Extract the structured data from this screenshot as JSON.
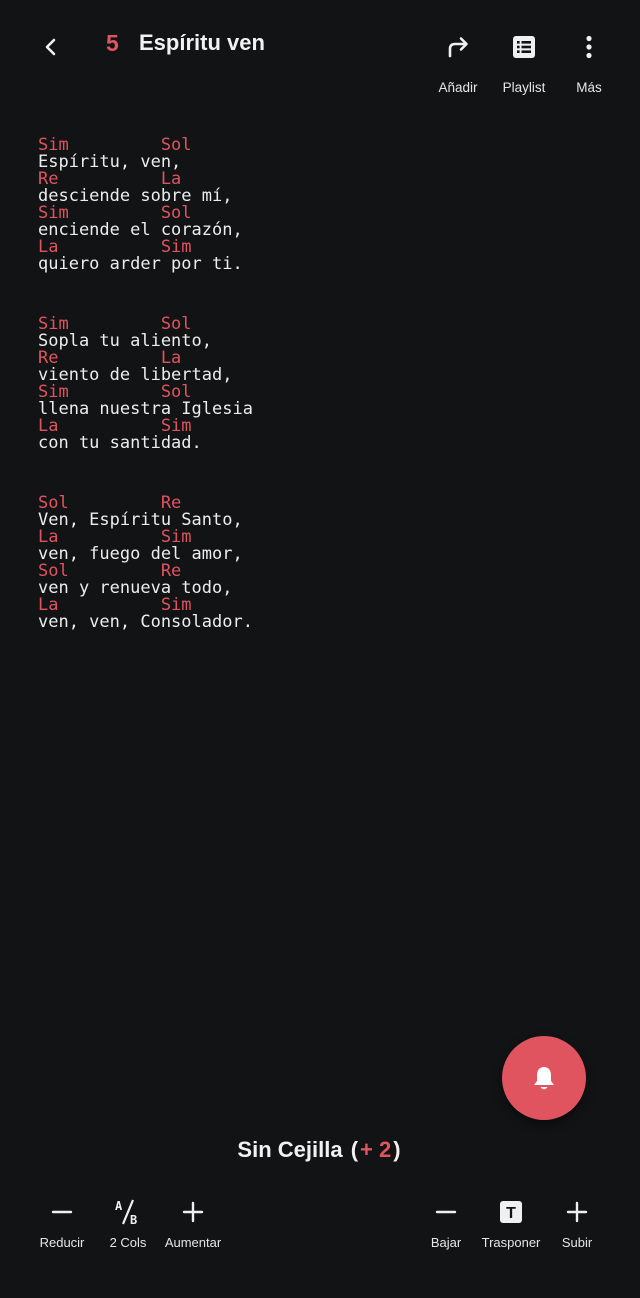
{
  "header": {
    "back_icon": "chevron-left-icon",
    "song_number": "5",
    "song_title": "Espíritu ven",
    "actions": [
      {
        "label": "Añadir",
        "icon": "share-forward-icon"
      },
      {
        "label": "Playlist",
        "icon": "list-icon"
      },
      {
        "label": "Más",
        "icon": "more-vertical-icon"
      }
    ]
  },
  "lyrics": {
    "stanzas": [
      [
        {
          "chord": true,
          "text": "Sim         Sol"
        },
        {
          "chord": false,
          "text": "Espíritu, ven,"
        },
        {
          "chord": true,
          "text": "Re          La"
        },
        {
          "chord": false,
          "text": "desciende sobre mí,"
        },
        {
          "chord": true,
          "text": "Sim         Sol"
        },
        {
          "chord": false,
          "text": "enciende el corazón,"
        },
        {
          "chord": true,
          "text": "La          Sim"
        },
        {
          "chord": false,
          "text": "quiero arder por ti."
        }
      ],
      [
        {
          "chord": true,
          "text": "Sim         Sol"
        },
        {
          "chord": false,
          "text": "Sopla tu aliento,"
        },
        {
          "chord": true,
          "text": "Re          La"
        },
        {
          "chord": false,
          "text": "viento de libertad,"
        },
        {
          "chord": true,
          "text": "Sim         Sol"
        },
        {
          "chord": false,
          "text": "llena nuestra Iglesia"
        },
        {
          "chord": true,
          "text": "La          Sim"
        },
        {
          "chord": false,
          "text": "con tu santidad."
        }
      ],
      [
        {
          "chord": true,
          "text": "Sol         Re"
        },
        {
          "chord": false,
          "text": "Ven, Espíritu Santo,"
        },
        {
          "chord": true,
          "text": "La          Sim"
        },
        {
          "chord": false,
          "text": "ven, fuego del amor,"
        },
        {
          "chord": true,
          "text": "Sol         Re"
        },
        {
          "chord": false,
          "text": "ven y renueva todo,"
        },
        {
          "chord": true,
          "text": "La          Sim"
        },
        {
          "chord": false,
          "text": "ven, ven, Consolador."
        }
      ]
    ]
  },
  "fab": {
    "icon": "bell-icon"
  },
  "capo": {
    "label": "Sin Cejilla",
    "open": "(",
    "value": "+ 2",
    "close": ")"
  },
  "toolbar": {
    "reduce_label": "Reducir",
    "columns_label": "2 Cols",
    "columns_icon_text": "A/B",
    "increase_label": "Aumentar",
    "down_label": "Bajar",
    "transpose_label": "Trasponer",
    "transpose_icon_text": "T",
    "up_label": "Subir"
  },
  "colors": {
    "accent": "#e0545f",
    "background": "#121315",
    "text": "#ececec"
  }
}
